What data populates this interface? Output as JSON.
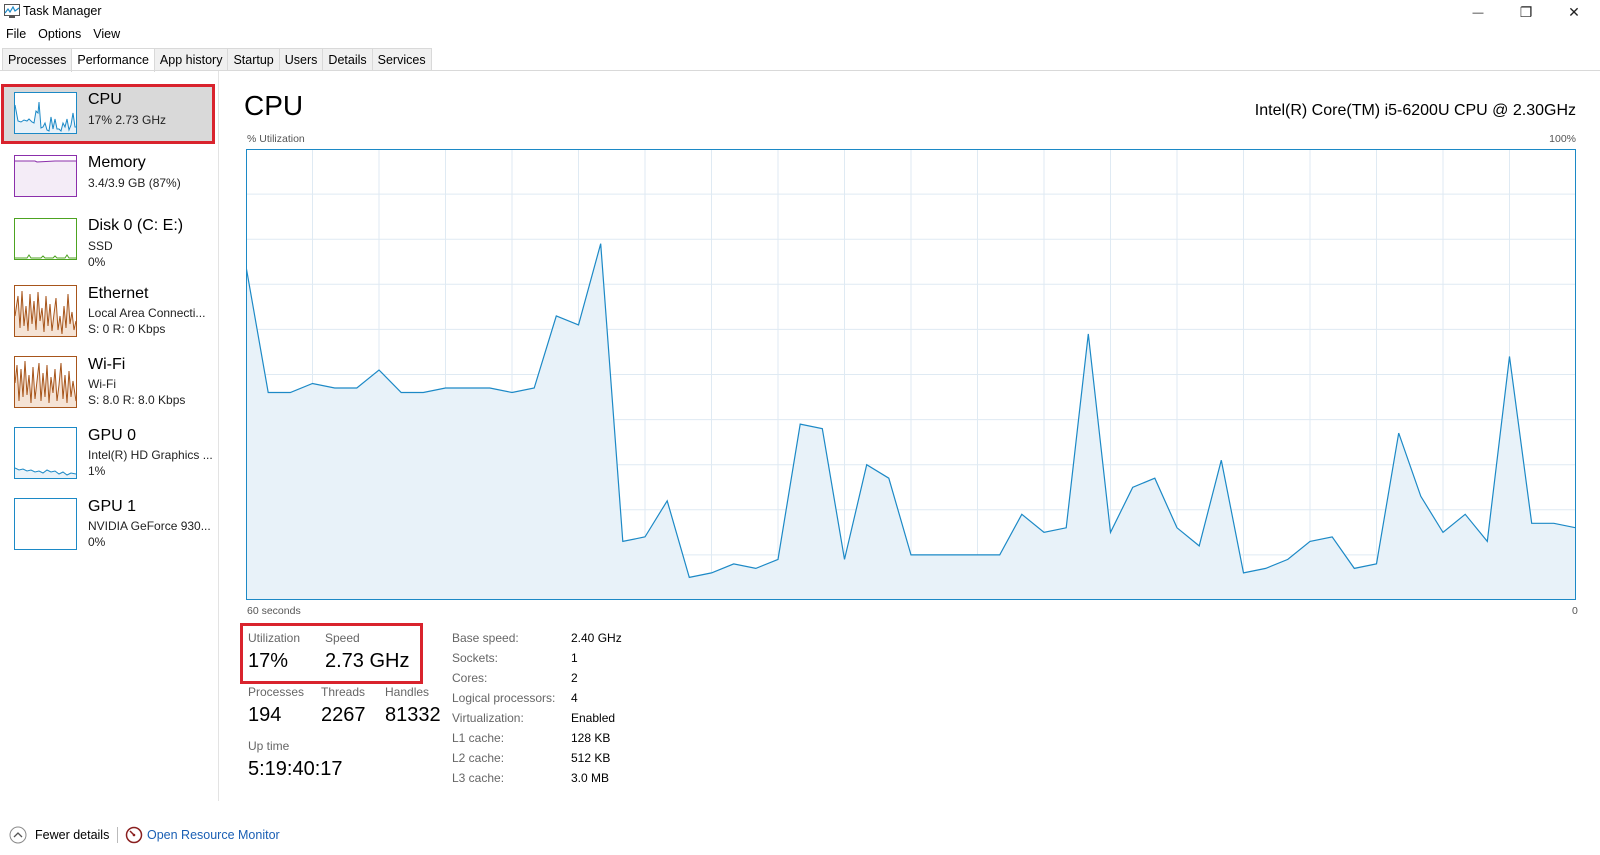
{
  "window": {
    "title": "Task Manager",
    "minimize_glyph": "—",
    "restore_glyph": "❐",
    "close_glyph": "✕"
  },
  "menu": [
    "File",
    "Options",
    "View"
  ],
  "tabs": [
    "Processes",
    "Performance",
    "App history",
    "Startup",
    "Users",
    "Details",
    "Services"
  ],
  "active_tab": "Performance",
  "sidebar": [
    {
      "title": "CPU",
      "lines": [
        "17%  2.73 GHz"
      ],
      "selected": true,
      "color": "#1c89c6"
    },
    {
      "title": "Memory",
      "lines": [
        "3.4/3.9 GB (87%)"
      ],
      "color": "#8b2fab"
    },
    {
      "title": "Disk 0 (C: E:)",
      "lines": [
        "SSD",
        "0%"
      ],
      "color": "#4da321"
    },
    {
      "title": "Ethernet",
      "lines": [
        "Local Area Connecti...",
        "S: 0 R: 0 Kbps"
      ],
      "color": "#a7551b"
    },
    {
      "title": "Wi-Fi",
      "lines": [
        "Wi-Fi",
        "S: 8.0 R: 8.0 Kbps"
      ],
      "color": "#a7551b"
    },
    {
      "title": "GPU 0",
      "lines": [
        "Intel(R) HD Graphics ...",
        "1%"
      ],
      "color": "#1c89c6"
    },
    {
      "title": "GPU 1",
      "lines": [
        "NVIDIA GeForce 930...",
        "0%"
      ],
      "color": "#1c89c6"
    }
  ],
  "main": {
    "title": "CPU",
    "model": "Intel(R) Core(TM) i5-6200U CPU @ 2.30GHz",
    "y_label": "% Utilization",
    "y_max_label": "100%",
    "x_left_label": "60 seconds",
    "x_right_label": "0"
  },
  "chart_data": {
    "type": "area",
    "x_label": "60 seconds",
    "y_label": "% Utilization",
    "ylim": [
      0,
      100
    ],
    "x": [
      60,
      59,
      58,
      57,
      56,
      55,
      54,
      53,
      52,
      51,
      50,
      49,
      48,
      47,
      46,
      45,
      44,
      43,
      42,
      41,
      40,
      39,
      38,
      37,
      36,
      35,
      34,
      33,
      32,
      31,
      30,
      29,
      28,
      27,
      26,
      25,
      24,
      23,
      22,
      21,
      20,
      19,
      18,
      17,
      16,
      15,
      14,
      13,
      12,
      11,
      10,
      9,
      8,
      7,
      6,
      5,
      4,
      3,
      2,
      1,
      0
    ],
    "values": [
      74,
      46,
      46,
      48,
      47,
      47,
      51,
      46,
      46,
      47,
      47,
      47,
      46,
      47,
      63,
      61,
      79,
      13,
      14,
      22,
      5,
      6,
      8,
      7,
      9,
      39,
      38,
      9,
      30,
      27,
      10,
      10,
      10,
      10,
      10,
      19,
      15,
      16,
      59,
      15,
      25,
      27,
      16,
      12,
      31,
      6,
      7,
      9,
      13,
      14,
      7,
      8,
      37,
      23,
      15,
      19,
      13,
      54,
      17,
      17,
      16
    ],
    "line_color": "#1c89c6",
    "fill_color": "#e8f2f9",
    "grid": true
  },
  "stats": {
    "utilization_label": "Utilization",
    "utilization_value": "17%",
    "speed_label": "Speed",
    "speed_value": "2.73 GHz",
    "processes_label": "Processes",
    "processes_value": "194",
    "threads_label": "Threads",
    "threads_value": "2267",
    "handles_label": "Handles",
    "handles_value": "81332",
    "uptime_label": "Up time",
    "uptime_value": "5:19:40:17"
  },
  "info": [
    {
      "label": "Base speed:",
      "value": "2.40 GHz"
    },
    {
      "label": "Sockets:",
      "value": "1"
    },
    {
      "label": "Cores:",
      "value": "2"
    },
    {
      "label": "Logical processors:",
      "value": "4"
    },
    {
      "label": "Virtualization:",
      "value": "Enabled"
    },
    {
      "label": "L1 cache:",
      "value": "128 KB"
    },
    {
      "label": "L2 cache:",
      "value": "512 KB"
    },
    {
      "label": "L3 cache:",
      "value": "3.0 MB"
    }
  ],
  "footer": {
    "fewer_details": "Fewer details",
    "open_resource_monitor": "Open Resource Monitor",
    "link_color": "#1a5fb4"
  }
}
